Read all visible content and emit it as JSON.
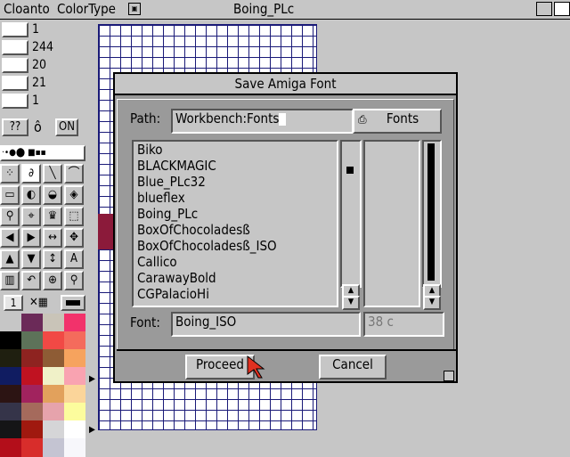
{
  "menubar": {
    "app": "Cloanto",
    "menu": "ColorType",
    "window_title": "Boing_PLc"
  },
  "toolbar": {
    "rows": [
      {
        "icon": "grid-icon",
        "value": "1"
      },
      {
        "icon": "frame-icon",
        "value": "244"
      },
      {
        "icon": "width-icon",
        "value": "20"
      },
      {
        "icon": "box-icon",
        "value": "21"
      },
      {
        "icon": "dotted-box-icon",
        "value": "1"
      }
    ],
    "help_label": "??",
    "on_label": "ON",
    "scale_label": "1"
  },
  "dialog": {
    "title": "Save Amiga Font",
    "path_label": "Path:",
    "path_value": "Workbench:Fonts",
    "fonts_button": "Fonts",
    "files": [
      "Biko",
      "BLACKMAGIC",
      "Blue_PLc32",
      "blueflex",
      "Boing_PLc",
      "BoxOfChocoladesß",
      "BoxOfChocoladesß_ISO",
      "Callico",
      "CarawayBold",
      "CGPalacioHi"
    ],
    "font_label": "Font:",
    "font_value": "Boing_ISO",
    "size_value": "38 c",
    "proceed_button": "Proceed",
    "cancel_button": "Cancel"
  },
  "colors": {
    "grid_line": "#1a1a78",
    "palette": [
      "#6b2a58",
      "#c9c4b8",
      "#f2326b",
      "#000000",
      "#5d7259",
      "#f14945",
      "#f46b5c",
      "#1f1f10",
      "#8e2320",
      "#8e5c35",
      "#f6a35e",
      "#101c61",
      "#c01221",
      "#f0f1c8",
      "#f9a3b1",
      "#2c1413",
      "#a1235e",
      "#e2a15c",
      "#fbd59a",
      "#353449",
      "#a56a5c",
      "#e6a3ac",
      "#fcfc9d",
      "#151516",
      "#a0190f",
      "#d5d5d7",
      "#ffffff",
      "#b30e1a",
      "#d82d2b",
      "#c4c4d2",
      "#f7f7fb"
    ]
  }
}
